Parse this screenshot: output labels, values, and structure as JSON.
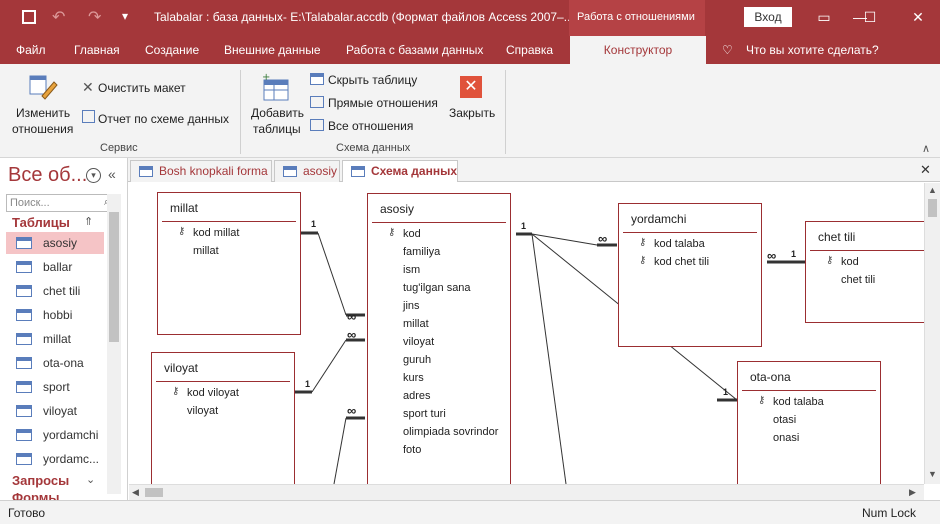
{
  "titlebar": {
    "title": "Talabalar : база данных- E:\\Talabalar.accdb (Формат файлов Access 2007–...",
    "context_tab": "Работа с отношениями",
    "login": "Вход"
  },
  "ribbon_tabs": [
    "Файл",
    "Главная",
    "Создание",
    "Внешние данные",
    "Работа с базами данных",
    "Справка",
    "Конструктор"
  ],
  "tell_me": "Что вы хотите сделать?",
  "ribbon": {
    "edit_rel": [
      "Изменить",
      "отношения"
    ],
    "clear_layout": "Очистить макет",
    "rel_report": "Отчет по схеме данных",
    "group_service": "Сервис",
    "add_tables": [
      "Добавить",
      "таблицы"
    ],
    "hide_table": "Скрыть таблицу",
    "direct_rel": "Прямые отношения",
    "all_rel": "Все отношения",
    "close": "Закрыть",
    "group_schema": "Схема данных"
  },
  "nav": {
    "title": "Все об...",
    "search_placeholder": "Поиск...",
    "section_tables": "Таблицы",
    "items": [
      "asosiy",
      "ballar",
      "chet tili",
      "hobbi",
      "millat",
      "ota-ona",
      "sport",
      "viloyat",
      "yordamchi",
      "yordamc..."
    ],
    "section_queries": "Запросы",
    "section_forms": "Формы"
  },
  "doc_tabs": [
    "Bosh knopkali forma",
    "asosiy",
    "Схема данных"
  ],
  "tables": {
    "millat": {
      "title": "millat",
      "fields": [
        "kod millat",
        "millat"
      ]
    },
    "viloyat": {
      "title": "viloyat",
      "fields": [
        "kod viloyat",
        "viloyat"
      ]
    },
    "asosiy": {
      "title": "asosiy",
      "fields": [
        "kod",
        "familiya",
        "ism",
        "tug'ilgan sana",
        "jins",
        "millat",
        "viloyat",
        "guruh",
        "kurs",
        "adres",
        "sport turi",
        "olimpiada sovrindor",
        "foto"
      ]
    },
    "yordamchi": {
      "title": "yordamchi",
      "fields": [
        "kod talaba",
        "kod chet tili"
      ]
    },
    "chet_tili": {
      "title": "chet tili",
      "fields": [
        "kod",
        "chet tili"
      ]
    },
    "ota_ona": {
      "title": "ota-ona",
      "fields": [
        "kod talaba",
        "otasi",
        "onasi"
      ]
    }
  },
  "rel_labels": {
    "one": "1",
    "many": "∞"
  },
  "status": {
    "left": "Готово",
    "right": "Num Lock"
  },
  "colors": {
    "accent": "#a4373a",
    "selected": "#f5c4c6"
  }
}
